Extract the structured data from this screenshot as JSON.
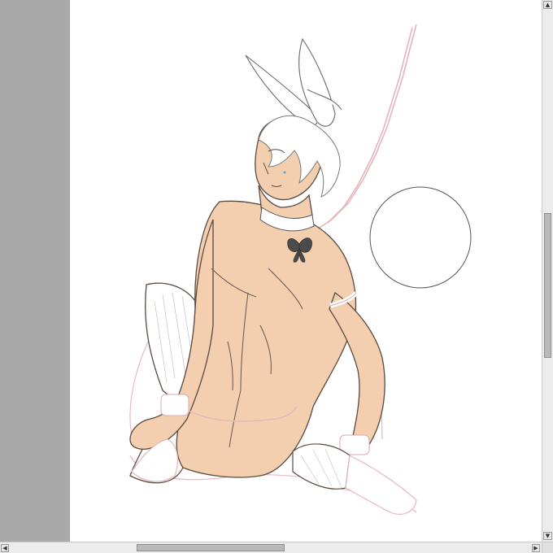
{
  "colors": {
    "left_pane": "#a9a9a9",
    "canvas_bg": "#ffffff",
    "skin": "#f3cfaf",
    "lineart": "#5a4a40",
    "sketch_pink": "#e9b9bc",
    "hair": "#d8d8d8"
  },
  "icons": {
    "scroll_up": "▲",
    "scroll_down": "▼",
    "scroll_left": "◀",
    "scroll_right": "▶"
  }
}
